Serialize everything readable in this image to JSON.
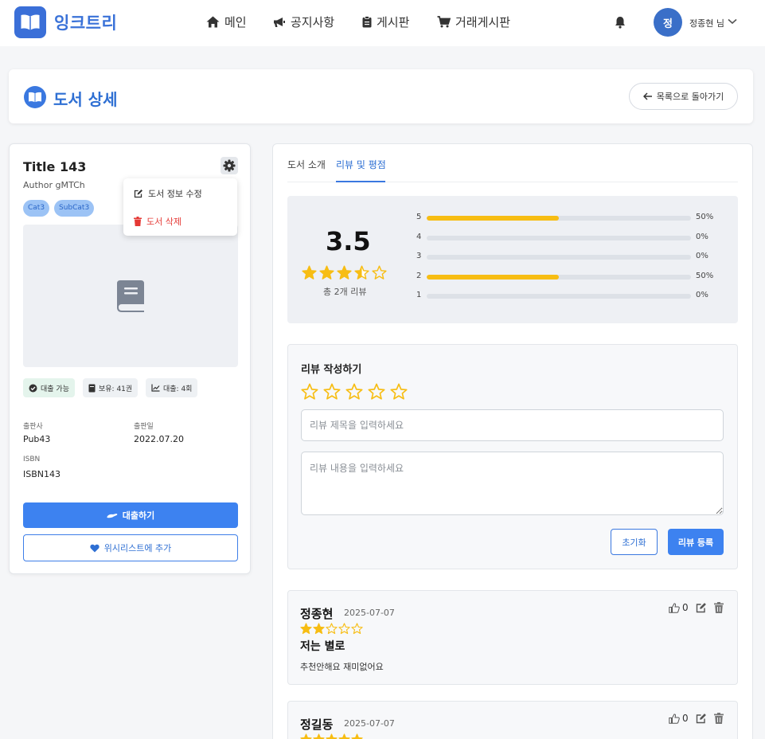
{
  "brand": {
    "name": "잉크트리"
  },
  "nav": {
    "items": [
      {
        "label": "메인",
        "icon": "home-icon"
      },
      {
        "label": "공지사항",
        "icon": "megaphone-icon"
      },
      {
        "label": "게시판",
        "icon": "clipboard-icon"
      },
      {
        "label": "거래게시판",
        "icon": "cart-icon"
      }
    ]
  },
  "user": {
    "avatar_initial": "정",
    "name": "정종현 님"
  },
  "page": {
    "title": "도서 상세",
    "back_label": "목록으로 돌아가기"
  },
  "book": {
    "title": "Title 143",
    "author": "Author gMTCh",
    "tags": [
      "Cat3",
      "SubCat3"
    ],
    "stats": {
      "available": "대출 가능",
      "owned": "보유: 41권",
      "loans": "대출: 4회"
    },
    "publisher_label": "출판사",
    "publisher": "Pub43",
    "published_label": "출판일",
    "published": "2022.07.20",
    "isbn_label": "ISBN",
    "isbn": "ISBN143",
    "borrow_label": "대출하기",
    "wishlist_label": "위시리스트에 추가"
  },
  "menu": {
    "edit_label": "도서 정보 수정",
    "delete_label": "도서 삭제"
  },
  "tabs": [
    {
      "label": "도서 소개",
      "active": false
    },
    {
      "label": "리뷰 및 평점",
      "active": true
    }
  ],
  "rating": {
    "average": "3.5",
    "average_value": 3.5,
    "total_label": "총 2개 리뷰",
    "distribution": [
      {
        "star": "5",
        "fraction": 0.5,
        "percent": "50%"
      },
      {
        "star": "4",
        "fraction": 0,
        "percent": "0%"
      },
      {
        "star": "3",
        "fraction": 0,
        "percent": "0%"
      },
      {
        "star": "2",
        "fraction": 0.5,
        "percent": "50%"
      },
      {
        "star": "1",
        "fraction": 0,
        "percent": "0%"
      }
    ]
  },
  "review_form": {
    "title": "리뷰 작성하기",
    "title_placeholder": "리뷰 제목을 입력하세요",
    "body_placeholder": "리뷰 내용을 입력하세요",
    "reset_label": "초기화",
    "submit_label": "리뷰 등록"
  },
  "reviews": [
    {
      "author": "정종현",
      "date": "2025-07-07",
      "rating": 2,
      "title": "저는 별로",
      "body": "추천안해요 재미없어요",
      "likes": "0"
    },
    {
      "author": "정길동",
      "date": "2025-07-07",
      "rating": 5,
      "title": "",
      "body": "",
      "likes": "0"
    }
  ],
  "colors": {
    "accent": "#3d82f0",
    "brand": "#3a72d8",
    "star": "#f7bd13",
    "danger": "#e53935"
  }
}
